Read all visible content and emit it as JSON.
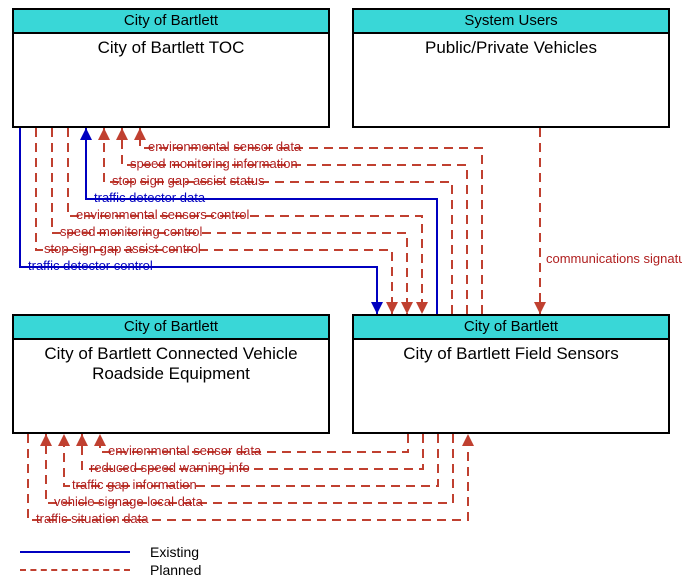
{
  "nodes": {
    "toc": {
      "header": "City of Bartlett",
      "body": "City of Bartlett TOC"
    },
    "users": {
      "header": "System Users",
      "body": "Public/Private Vehicles"
    },
    "cvre": {
      "header": "City of Bartlett",
      "body": "City of Bartlett Connected Vehicle Roadside Equipment"
    },
    "fs": {
      "header": "City of Bartlett",
      "body": "City of Bartlett Field Sensors"
    }
  },
  "flows_top": [
    {
      "key": "env_sensor_data_top",
      "label": "environmental sensor data",
      "style": "planned"
    },
    {
      "key": "speed_mon_info",
      "label": "speed monitoring information",
      "style": "planned"
    },
    {
      "key": "stop_gap_status",
      "label": "stop sign gap assist status",
      "style": "planned"
    },
    {
      "key": "traffic_det_data",
      "label": "traffic detector data",
      "style": "existing"
    },
    {
      "key": "env_sensors_ctrl",
      "label": "environmental sensors control",
      "style": "planned"
    },
    {
      "key": "speed_mon_ctrl",
      "label": "speed monitoring control",
      "style": "planned"
    },
    {
      "key": "stop_gap_ctrl",
      "label": "stop sign gap assist control",
      "style": "planned"
    },
    {
      "key": "traffic_det_ctrl",
      "label": "traffic detector control",
      "style": "existing"
    }
  ],
  "flows_right": [
    {
      "key": "comm_sig",
      "label": "communications signature",
      "style": "planned"
    }
  ],
  "flows_bottom": [
    {
      "key": "env_sensor_data_bot",
      "label": "environmental sensor data",
      "style": "planned"
    },
    {
      "key": "reduced_speed_warn",
      "label": "reduced speed warning info",
      "style": "planned"
    },
    {
      "key": "traffic_gap_info",
      "label": "traffic gap information",
      "style": "planned"
    },
    {
      "key": "veh_signage_local",
      "label": "vehicle signage local data",
      "style": "planned"
    },
    {
      "key": "traffic_situation",
      "label": "traffic situation data",
      "style": "planned"
    }
  ],
  "legend": {
    "existing": {
      "label": "Existing",
      "color": "#0000c0"
    },
    "planned": {
      "label": "Planned",
      "color": "#c04030"
    }
  },
  "chart_data": {
    "type": "diagram",
    "nodes": [
      {
        "id": "toc",
        "group": "City of Bartlett",
        "label": "City of Bartlett TOC"
      },
      {
        "id": "users",
        "group": "System Users",
        "label": "Public/Private Vehicles"
      },
      {
        "id": "cvre",
        "group": "City of Bartlett",
        "label": "City of Bartlett Connected Vehicle Roadside Equipment"
      },
      {
        "id": "fs",
        "group": "City of Bartlett",
        "label": "City of Bartlett Field Sensors"
      }
    ],
    "edges": [
      {
        "from": "fs",
        "to": "toc",
        "label": "environmental sensor data",
        "status": "Planned"
      },
      {
        "from": "fs",
        "to": "toc",
        "label": "speed monitoring information",
        "status": "Planned"
      },
      {
        "from": "fs",
        "to": "toc",
        "label": "stop sign gap assist status",
        "status": "Planned"
      },
      {
        "from": "fs",
        "to": "toc",
        "label": "traffic detector data",
        "status": "Existing"
      },
      {
        "from": "toc",
        "to": "fs",
        "label": "environmental sensors control",
        "status": "Planned"
      },
      {
        "from": "toc",
        "to": "fs",
        "label": "speed monitoring control",
        "status": "Planned"
      },
      {
        "from": "toc",
        "to": "fs",
        "label": "stop sign gap assist control",
        "status": "Planned"
      },
      {
        "from": "toc",
        "to": "fs",
        "label": "traffic detector control",
        "status": "Existing"
      },
      {
        "from": "users",
        "to": "fs",
        "label": "communications signature",
        "status": "Planned"
      },
      {
        "from": "fs",
        "to": "cvre",
        "label": "environmental sensor data",
        "status": "Planned"
      },
      {
        "from": "fs",
        "to": "cvre",
        "label": "reduced speed warning info",
        "status": "Planned"
      },
      {
        "from": "fs",
        "to": "cvre",
        "label": "traffic gap information",
        "status": "Planned"
      },
      {
        "from": "fs",
        "to": "cvre",
        "label": "vehicle signage local data",
        "status": "Planned"
      },
      {
        "from": "cvre",
        "to": "fs",
        "label": "traffic situation data",
        "status": "Planned"
      }
    ],
    "legend": [
      {
        "label": "Existing",
        "style": "solid",
        "color": "#0000c0"
      },
      {
        "label": "Planned",
        "style": "dashed",
        "color": "#c04030"
      }
    ]
  }
}
